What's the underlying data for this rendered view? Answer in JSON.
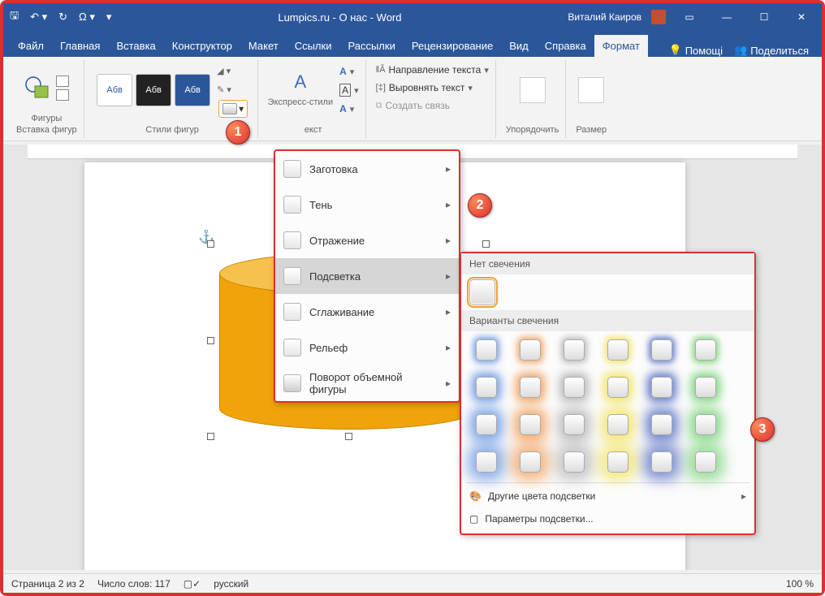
{
  "titlebar": {
    "title": "Lumpics.ru - О нас  -  Word",
    "user": "Виталий Каиров"
  },
  "tabs": {
    "file": "Файл",
    "home": "Главная",
    "insert": "Вставка",
    "designer": "Конструктор",
    "layout": "Макет",
    "refs": "Ссылки",
    "mail": "Рассылки",
    "review": "Рецензирование",
    "view": "Вид",
    "help": "Справка",
    "format": "Формат",
    "assistant": "Помощі",
    "share": "Поделиться"
  },
  "ribbon": {
    "shapes": "Фигуры",
    "insert_shapes": "Вставка фигур",
    "style_label": "Абв",
    "shape_styles": "Стили фигур",
    "express": "Экспресс-стили",
    "wordart": "екст",
    "text_dir": "Направление текста",
    "align_text": "Выровнять текст",
    "create_link": "Создать связь",
    "arrange": "Упорядочить",
    "size": "Размер"
  },
  "effects_menu": {
    "preset": "Заготовка",
    "shadow": "Тень",
    "reflection": "Отражение",
    "glow": "Подсветка",
    "softedge": "Сглаживание",
    "bevel": "Рельеф",
    "rotate3d": "Поворот объемной фигуры"
  },
  "glow_panel": {
    "no_glow": "Нет свечения",
    "variants": "Варианты свечения",
    "more_colors": "Другие цвета подсветки",
    "options": "Параметры подсветки..."
  },
  "statusbar": {
    "page": "Страница 2 из 2",
    "words": "Число слов: 117",
    "lang": "русский",
    "zoom": "100 %"
  },
  "badges": {
    "b1": "1",
    "b2": "2",
    "b3": "3"
  }
}
